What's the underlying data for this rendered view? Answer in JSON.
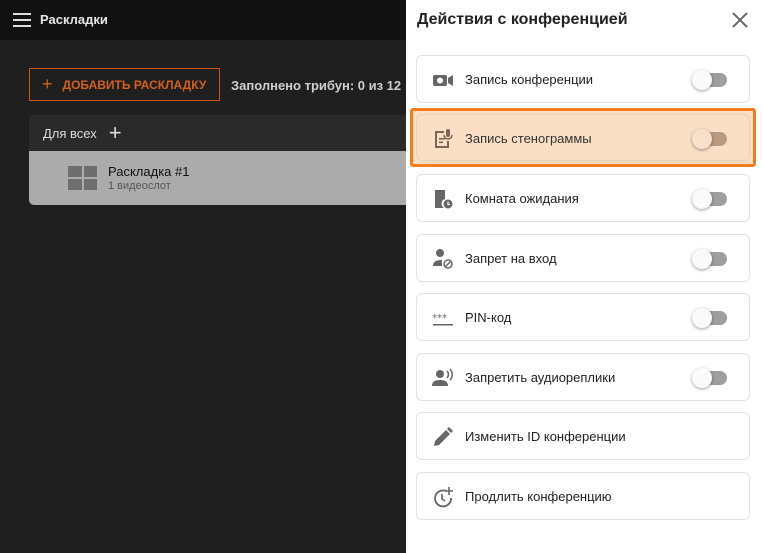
{
  "header": {
    "title": "Раскладки",
    "menu_icon": "hamburger-icon"
  },
  "toolbar": {
    "add_label": "ДОБАВИТЬ РАСКЛАДКУ",
    "filled_text": "Заполнено трибун: 0 из 12"
  },
  "group": {
    "title": "Для всех",
    "layout": {
      "name": "Раскладка #1",
      "sub": "1 видеослот"
    }
  },
  "panel": {
    "title": "Действия с конференцией",
    "items": [
      {
        "label": "Запись конференции",
        "icon": "video-camera-icon",
        "toggle": false
      },
      {
        "label": "Запись стенограммы",
        "icon": "transcript-mic-icon",
        "toggle": false,
        "highlighted": true
      },
      {
        "label": "Комната ожидания",
        "icon": "waiting-room-icon",
        "toggle": false
      },
      {
        "label": "Запрет на вход",
        "icon": "user-blocked-icon",
        "toggle": false
      },
      {
        "label": "PIN-код",
        "icon": "pin-code-icon",
        "toggle": false
      },
      {
        "label": "Запретить аудиореплики",
        "icon": "speaking-user-icon",
        "toggle": false
      },
      {
        "label": "Изменить ID конференции",
        "icon": "pencil-icon"
      },
      {
        "label": "Продлить конференцию",
        "icon": "clock-plus-icon"
      }
    ]
  },
  "colors": {
    "accent": "#d2611f",
    "highlight": "#f47c20"
  }
}
